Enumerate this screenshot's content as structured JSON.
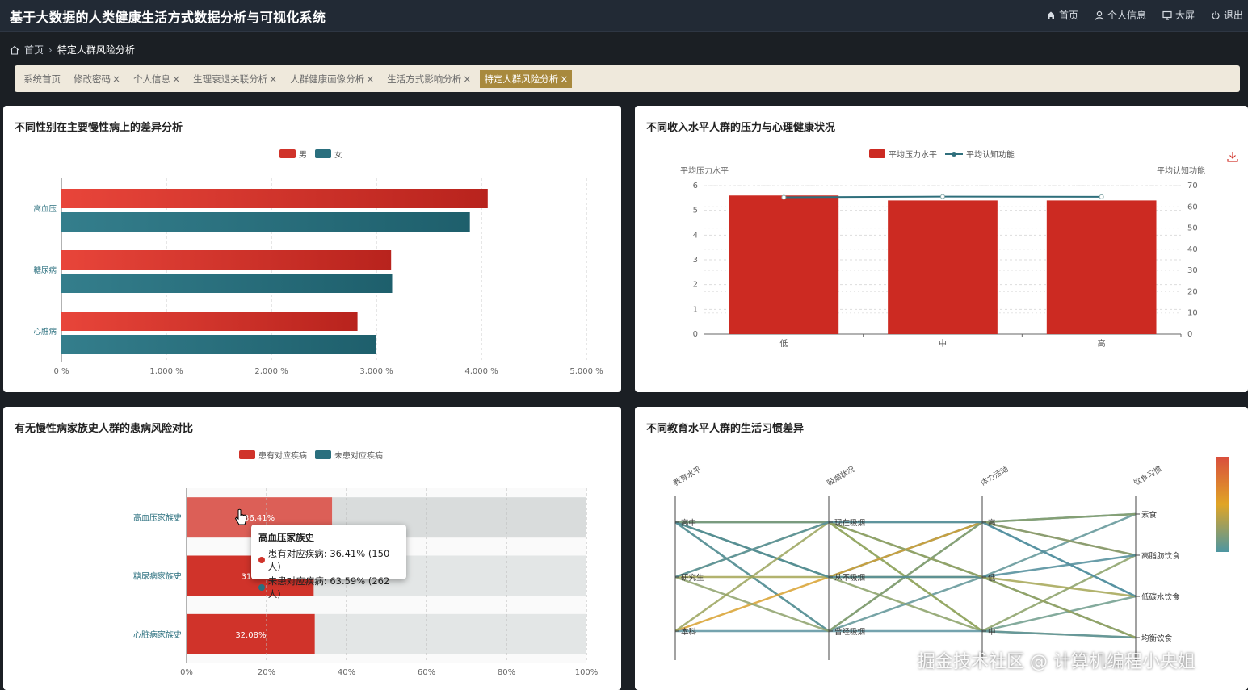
{
  "app": {
    "title": "基于大数据的人类健康生活方式数据分析与可视化系统",
    "nav": [
      {
        "label": "首页",
        "icon": "home-icon"
      },
      {
        "label": "个人信息",
        "icon": "user-icon"
      },
      {
        "label": "大屏",
        "icon": "monitor-icon"
      },
      {
        "label": "退出",
        "icon": "power-icon"
      }
    ]
  },
  "breadcrumb": {
    "home": "首页",
    "current": "特定人群风险分析"
  },
  "tabs": [
    {
      "label": "系统首页",
      "closable": false
    },
    {
      "label": "修改密码",
      "closable": true
    },
    {
      "label": "个人信息",
      "closable": true
    },
    {
      "label": "生理衰退关联分析",
      "closable": true
    },
    {
      "label": "人群健康画像分析",
      "closable": true
    },
    {
      "label": "生活方式影响分析",
      "closable": true
    },
    {
      "label": "特定人群风险分析",
      "closable": true,
      "active": true
    }
  ],
  "colors": {
    "red": "#d0332a",
    "teal": "#2a6f7e",
    "line": "#2f6f7c",
    "active_tab": "#a8893d"
  },
  "panels": {
    "gender": {
      "title": "不同性别在主要慢性病上的差异分析"
    },
    "income": {
      "title": "不同收入水平人群的压力与心理健康状况"
    },
    "family": {
      "title": "有无慢性病家族史人群的患病风险对比"
    },
    "education": {
      "title": "不同教育水平人群的生活习惯差异"
    }
  },
  "tooltip": {
    "title": "高血压家族史",
    "rows": [
      {
        "label": "患有对应疾病: 36.41% (150人)",
        "color": "#d0332a"
      },
      {
        "label": "未患对应疾病: 63.59% (262人)",
        "color": "#2a6f7e"
      }
    ]
  },
  "watermark": "掘金技术社区 @ 计算机编程小央姐",
  "chart_data": [
    {
      "type": "bar",
      "orientation": "horizontal",
      "title": "不同性别在主要慢性病上的差异分析",
      "categories": [
        "高血压",
        "糖尿病",
        "心脏病"
      ],
      "series": [
        {
          "name": "男",
          "values": [
            4060,
            3140,
            2820
          ],
          "color": "#d0332a"
        },
        {
          "name": "女",
          "values": [
            3890,
            3150,
            3000
          ],
          "color": "#2a6f7e"
        }
      ],
      "x_ticks": [
        "0 %",
        "1,000 %",
        "2,000 %",
        "3,000 %",
        "4,000 %",
        "5,000 %"
      ],
      "xlim": [
        0,
        5000
      ],
      "legend": "top-center",
      "grid": true
    },
    {
      "type": "bar",
      "title": "不同收入水平人群的压力与心理健康状况",
      "categories": [
        "低",
        "中",
        "高"
      ],
      "series": [
        {
          "name": "平均压力水平",
          "type": "bar",
          "values": [
            5.6,
            5.4,
            5.4
          ],
          "color": "#cc2a22"
        },
        {
          "name": "平均认知功能",
          "type": "line",
          "values": [
            64.5,
            64.8,
            64.7
          ],
          "color": "#2f6f7c"
        }
      ],
      "ylabel": "平均压力水平",
      "y2label": "平均认知功能",
      "ylim": [
        0,
        6
      ],
      "y_ticks": [
        "0",
        "1",
        "2",
        "3",
        "4",
        "5",
        "6"
      ],
      "y2lim": [
        0,
        70
      ],
      "y2_ticks": [
        "0",
        "10",
        "20",
        "30",
        "40",
        "50",
        "60",
        "70"
      ],
      "legend": "top-center",
      "grid": true
    },
    {
      "type": "bar",
      "orientation": "horizontal",
      "stacked": true,
      "title": "有无慢性病家族史人群的患病风险对比",
      "categories": [
        "高血压家族史",
        "糖尿病家族史",
        "心脏病家族史"
      ],
      "series": [
        {
          "name": "患有对应疾病",
          "values": [
            36.41,
            31.8,
            32.08
          ],
          "labels": [
            "36.41%",
            "31.8",
            "32.08%"
          ],
          "color": "#d0332a"
        },
        {
          "name": "未患对应疾病",
          "values": [
            63.59,
            68.2,
            67.92
          ],
          "color": "#e5e8e8"
        }
      ],
      "x_ticks": [
        "0%",
        "20%",
        "40%",
        "60%",
        "80%",
        "100%"
      ],
      "xlim": [
        0,
        100
      ],
      "legend": "top-center",
      "grid": true
    },
    {
      "type": "parallel",
      "title": "不同教育水平人群的生活习惯差异",
      "axes": [
        {
          "name": "教育水平",
          "categories": [
            "高中",
            "研究生",
            "本科"
          ]
        },
        {
          "name": "吸烟状况",
          "categories": [
            "现在吸烟",
            "从不吸烟",
            "曾经吸烟"
          ]
        },
        {
          "name": "体力活动",
          "categories": [
            "高",
            "低",
            "中"
          ]
        },
        {
          "name": "饮食习惯",
          "categories": [
            "素食",
            "高脂肪饮食",
            "低碳水饮食",
            "均衡饮食"
          ]
        }
      ],
      "visual_map": [
        "#d94e3d",
        "#e0a526",
        "#4d96a1"
      ]
    }
  ]
}
